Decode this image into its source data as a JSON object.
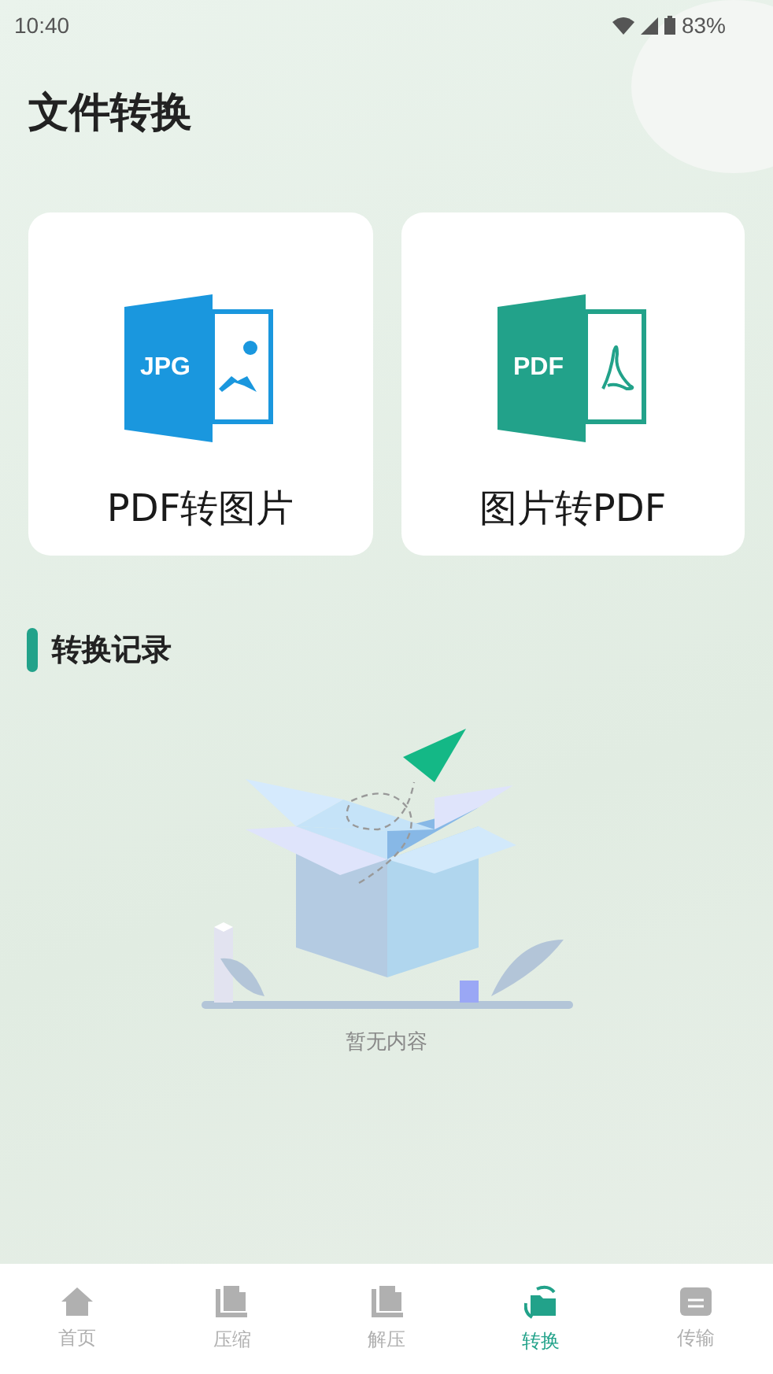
{
  "status_bar": {
    "time": "10:40",
    "battery": "83%"
  },
  "title": "文件转换",
  "cards": [
    {
      "kind": "jpg",
      "badge": "JPG",
      "label": "PDF转图片"
    },
    {
      "kind": "pdf",
      "badge": "PDF",
      "label": "图片转PDF"
    }
  ],
  "section": {
    "title": "转换记录",
    "empty_text": "暂无内容"
  },
  "tabs": [
    {
      "kind": "home",
      "label": "首页",
      "selected": false
    },
    {
      "kind": "compress",
      "label": "压缩",
      "selected": false
    },
    {
      "kind": "extract",
      "label": "解压",
      "selected": false
    },
    {
      "kind": "convert",
      "label": "转换",
      "selected": true
    },
    {
      "kind": "transfer",
      "label": "传输",
      "selected": false
    }
  ]
}
